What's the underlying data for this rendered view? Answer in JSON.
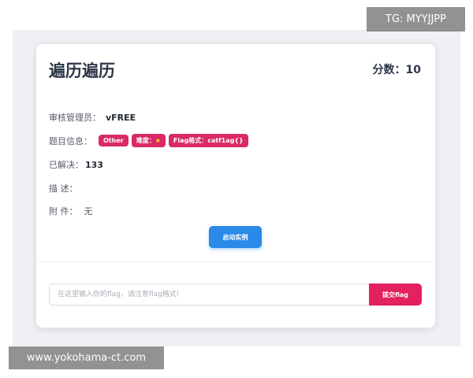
{
  "challenge": {
    "title": "遍历遍历",
    "score_label": "分数：",
    "score_value": "10",
    "reviewer_label": "审核管理员：",
    "reviewer_value": "vFREE",
    "info_label": "题目信息：",
    "tags": {
      "category": "Other",
      "difficulty_label": "难度：",
      "difficulty_star": "★",
      "flag_format": "Flag格式：catf1ag{}"
    },
    "solved_label": "已解决：",
    "solved_value": "133",
    "description_label": "描 述：",
    "attachment_label": "附 件：",
    "attachment_value": "无",
    "start_button": "启动实例"
  },
  "submit": {
    "placeholder": "在这里输入你的flag，请注意flag格式!",
    "button": "提交flag"
  },
  "watermarks": {
    "top": "TG: MYYJJPP",
    "bottom": "www.yokohama-ct.com"
  },
  "colors": {
    "tag": "#d92a65",
    "start_button": "#2b8ae8",
    "submit_button": "#e2215e",
    "backdrop": "#eef0f4"
  }
}
